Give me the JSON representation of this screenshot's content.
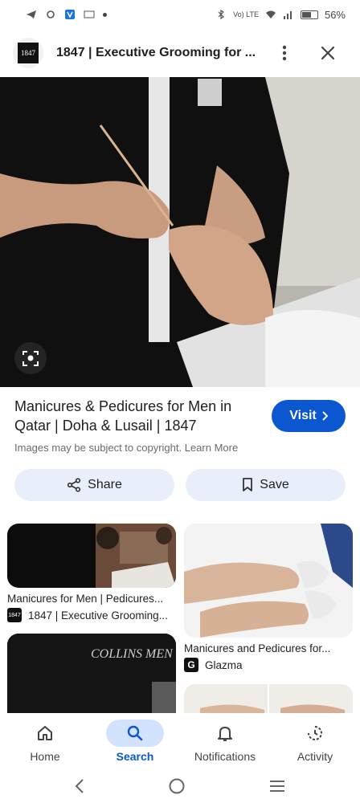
{
  "status_bar": {
    "network": "Vo) LTE",
    "battery": "56%",
    "icons": [
      "telegram-icon",
      "sync-icon",
      "app-icon",
      "notification-icon",
      "dot-icon",
      "bluetooth-icon",
      "wifi-icon",
      "signal-icon",
      "battery-icon"
    ]
  },
  "header": {
    "logo_text": "1847",
    "title": "1847 | Executive Grooming for ...",
    "icons": [
      "more-vert-icon",
      "close-icon"
    ]
  },
  "result": {
    "title": "Manicures & Pedicures for Men in Qatar | Doha & Lusail | 1847",
    "visit_label": "Visit",
    "copyright": "Images may be subject to copyright. Learn More",
    "share_label": "Share",
    "save_label": "Save"
  },
  "related": [
    {
      "caption": "Manicures for Men | Pedicures...",
      "source": "1847 | Executive Grooming...",
      "source_icon": "1847"
    },
    {
      "caption": "Manicures and Pedicures for...",
      "source": "Glazma",
      "source_icon": "G"
    },
    {
      "caption": "",
      "source": "",
      "image_text": "COLLINS MEN"
    }
  ],
  "bottom_nav": [
    {
      "label": "Home",
      "icon": "home-icon",
      "active": false
    },
    {
      "label": "Search",
      "icon": "search-icon",
      "active": true
    },
    {
      "label": "Notifications",
      "icon": "bell-icon",
      "active": false
    },
    {
      "label": "Activity",
      "icon": "activity-icon",
      "active": false
    }
  ],
  "colors": {
    "accent": "#0b57d0",
    "pill": "#e8effb",
    "nav_active": "#d3e3fd"
  }
}
